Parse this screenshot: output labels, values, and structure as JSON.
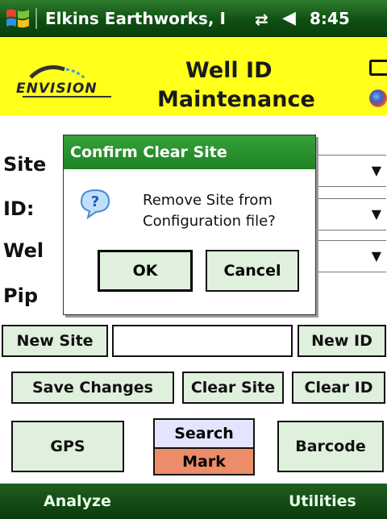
{
  "titlebar": {
    "title": "Elkins Earthworks, I",
    "network_icon": "connectivity-icon",
    "volume_icon": "speaker-icon",
    "time": "8:45"
  },
  "header": {
    "logo_text": "ENVISION",
    "title_line1": "Well ID",
    "title_line2": "Maintenance"
  },
  "form": {
    "site_label": "Site",
    "id_label": "ID:",
    "well_label": "Wel",
    "pipe_label": "Pip"
  },
  "buttons": {
    "new_site": "New Site",
    "new_id": "New ID",
    "save_changes": "Save Changes",
    "clear_site": "Clear Site",
    "clear_id": "Clear ID",
    "gps": "GPS",
    "search": "Search",
    "mark": "Mark",
    "barcode": "Barcode"
  },
  "dialog": {
    "title": "Confirm Clear Site",
    "message_line1": "Remove Site from",
    "message_line2": "Configuration file?",
    "ok": "OK",
    "cancel": "Cancel"
  },
  "softkeys": {
    "left": "Analyze",
    "right": "Utilities"
  },
  "colors": {
    "titlebar_green": "#0f4f12",
    "header_yellow": "#ffff1a",
    "button_green": "#dff0dc",
    "dialog_title_green": "#1f8224",
    "mark_orange": "#ec8c69",
    "search_blue": "#e4e4ff"
  }
}
